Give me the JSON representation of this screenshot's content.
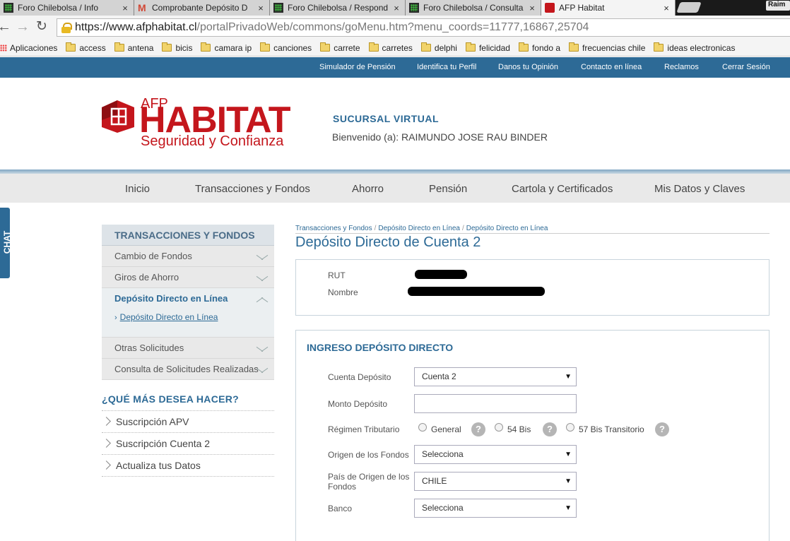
{
  "browser": {
    "tabs": [
      {
        "title": "Foro Chilebolsa / Info",
        "icon": "grid-icon"
      },
      {
        "title": "Comprobante Depósito D",
        "icon": "gmail-icon"
      },
      {
        "title": "Foro Chilebolsa / Respond",
        "icon": "grid-icon"
      },
      {
        "title": "Foro Chilebolsa / Consulta",
        "icon": "grid-icon"
      },
      {
        "title": "AFP Habitat",
        "icon": "habitat-icon",
        "active": true
      }
    ],
    "close_glyph": "×",
    "user_badge": "Raim",
    "url_host": "https://www.afphabitat.cl",
    "url_path": "/portalPrivadoWeb/commons/goMenu.htm?menu_coords=11777,16867,25704",
    "bookmarks": [
      "Aplicaciones",
      "access",
      "antena",
      "bicis",
      "camara ip",
      "canciones",
      "carrete",
      "carretes",
      "delphi",
      "felicidad",
      "fondo a",
      "frecuencias chile",
      "ideas electronicas"
    ]
  },
  "top_nav": [
    "Simulador de Pensión",
    "Identifica tu Perfil",
    "Danos tu Opinión",
    "Contacto en línea",
    "Reclamos",
    "Cerrar Sesión"
  ],
  "logo": {
    "afp": "AFP",
    "name": "HABITAT",
    "tagline": "Seguridad y Confianza",
    "color": "#c4161c"
  },
  "header": {
    "sucursal": "SUCURSAL VIRTUAL",
    "welcome": "Bienvenido (a): RAIMUNDO JOSE RAU BINDER"
  },
  "main_nav": [
    "Inicio",
    "Transacciones y Fondos",
    "Ahorro",
    "Pensión",
    "Cartola y Certificados",
    "Mis Datos y Claves"
  ],
  "chat_label": "CHAT",
  "sidebar": {
    "title": "TRANSACCIONES Y FONDOS",
    "items": [
      "Cambio de Fondos",
      "Giros de Ahorro",
      "Depósito Directo en Línea",
      "Otras Solicitudes",
      "Consulta de Solicitudes Realizadas"
    ],
    "sub_item": "Depósito Directo en Línea",
    "more_title": "¿QUÉ MÁS DESEA HACER?",
    "more_items": [
      "Suscripción APV",
      "Suscripción Cuenta 2",
      "Actualiza tus Datos"
    ]
  },
  "breadcrumb": [
    "Transacciones y Fondos",
    "Depósito Directo en Línea",
    "Depósito Directo en Línea"
  ],
  "breadcrumb_sep": "/",
  "page_title": "Depósito Directo de Cuenta 2",
  "account_box": {
    "rut_label": "RUT",
    "nombre_label": "Nombre"
  },
  "form": {
    "title": "INGRESO DEPÓSITO DIRECTO",
    "cuenta_label": "Cuenta Depósito",
    "cuenta_value": "Cuenta 2",
    "monto_label": "Monto Depósito",
    "monto_value": "",
    "regimen_label": "Régimen Tributario",
    "regimen_options": [
      "General",
      "54 Bis",
      "57 Bis Transitorio"
    ],
    "help_glyph": "?",
    "origen_label": "Origen de los Fondos",
    "origen_value": "Selecciona",
    "pais_label": "País de Origen de los Fondos",
    "pais_value": "CHILE",
    "banco_label": "Banco",
    "banco_value": "Selecciona"
  },
  "colors": {
    "brand_blue": "#2d6a96",
    "brand_red": "#c4161c"
  }
}
